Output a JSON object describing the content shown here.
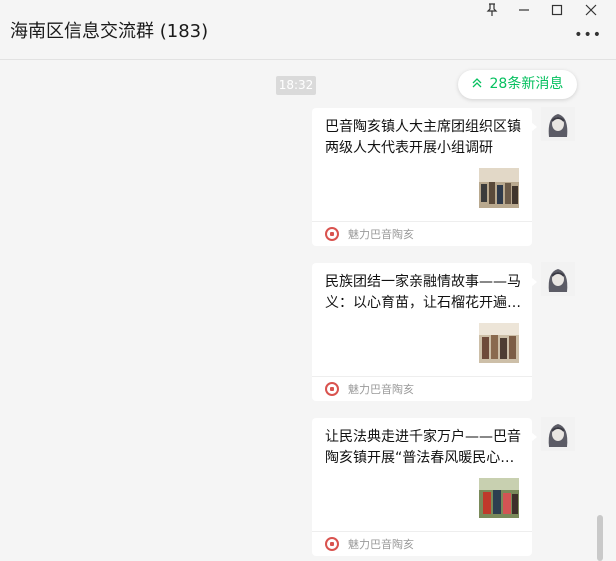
{
  "header": {
    "title": "海南区信息交流群 (183)"
  },
  "window_controls": {
    "pin_icon": "pin-icon",
    "minimize_icon": "minimize-icon",
    "maximize_icon": "maximize-icon",
    "close_icon": "close-icon"
  },
  "chat": {
    "timestamp": "18:32",
    "new_messages": {
      "label": "28条新消息",
      "icon": "double-chevron-up-icon",
      "color": "#07c160"
    },
    "messages": [
      {
        "title": "巴音陶亥镇人大主席团组织区镇两级人大代表开展小组调研",
        "source": "魅力巴音陶亥"
      },
      {
        "title": "民族团结一家亲融情故事——马义：以心育苗，让石榴花开遍…",
        "source": "魅力巴音陶亥"
      },
      {
        "title": "让民法典走进千家万户——巴音陶亥镇开展“普法春风暖民心…",
        "source": "魅力巴音陶亥"
      }
    ]
  },
  "colors": {
    "background": "#f5f5f5",
    "card": "#ffffff",
    "accent": "#07c160",
    "source_logo": "#d9534f"
  }
}
